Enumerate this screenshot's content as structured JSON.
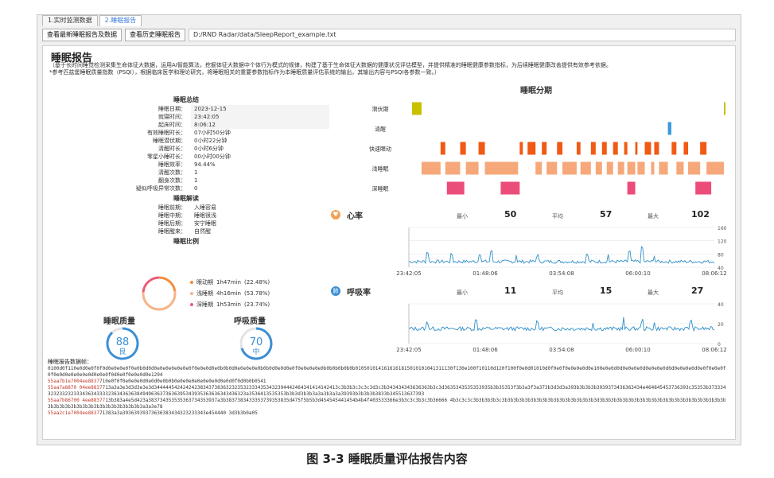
{
  "tabs": [
    {
      "label": "1.实时监测数据"
    },
    {
      "label": "2.睡眠报告"
    }
  ],
  "toolbar": {
    "btn_latest": "查看最新睡眠报告及数据",
    "btn_history": "查看历史睡眠报告",
    "path": "D:/RND Radar/data/SleepReport_example.txt"
  },
  "report": {
    "title": "睡眠报告",
    "intro1": "（基于长时间睡觉检测采集生命体征大数据，运用AI智能算法，挖掘体征大数据中个体行为模式的规律，构建了基于生命体征大数据的健康状况评估模型，并提供精准的睡眠健康参数指标，为后续睡眠健康改善提供有效参考依据。",
    "intro2": "*参考匹兹堡睡眠质量指数（PSQI），根据临床医学和理论研究，将睡眠相关的重要参数指标作为本睡眠质量评估系统的输出，其输出内容与PSQI各参数一致。）"
  },
  "summary": {
    "title": "睡眠总结",
    "rows": [
      {
        "k": "睡眠日期：",
        "v": "2023-12-15"
      },
      {
        "k": "就寝时间：",
        "v": "23:42:05"
      },
      {
        "k": "起床时间：",
        "v": "8:06:12"
      },
      {
        "k": "有效睡眠时长：",
        "v": "07小时50分钟"
      },
      {
        "k": "睡眠潜伏期：",
        "v": "0小时22分钟"
      },
      {
        "k": "清醒时长：",
        "v": "0小时6分钟"
      },
      {
        "k": "零星小睡时长：",
        "v": "00小时00分钟"
      },
      {
        "k": "睡眠效率：",
        "v": "94.44%"
      },
      {
        "k": "清醒次数：",
        "v": "1"
      },
      {
        "k": "翻身次数：",
        "v": "1"
      },
      {
        "k": "疑似呼吸异常次数：",
        "v": "0"
      }
    ],
    "interp_title": "睡眠解读",
    "interp": [
      {
        "k": "睡眠前期：",
        "v": "入睡容易"
      },
      {
        "k": "睡眠中期：",
        "v": "睡眠很浅"
      },
      {
        "k": "睡眠后期：",
        "v": "安宁睡眠"
      },
      {
        "k": "睡眠醒来：",
        "v": "自然醒"
      }
    ],
    "ratio_title": "睡眠比例",
    "ratio": [
      {
        "name": "眼动期",
        "time": "1h47min",
        "pct": "(22.48%)",
        "value": 22.48,
        "color": "#f28c3c"
      },
      {
        "name": "浅睡期",
        "time": "4h16min",
        "pct": "(53.78%)",
        "value": 53.78,
        "color": "#f6b48a"
      },
      {
        "name": "深睡期",
        "time": "1h53min",
        "pct": "(23.74%)",
        "value": 23.74,
        "color": "#ec5a78"
      }
    ]
  },
  "gauges": {
    "sleep": {
      "label": "睡眠质量",
      "score": "88",
      "grade": "良",
      "value": 88,
      "color": "#3b8fd6"
    },
    "breath": {
      "label": "呼吸质量",
      "score": "70",
      "grade": "中",
      "value": 70,
      "color": "#3b8fd6"
    }
  },
  "stages": {
    "title": "睡眠分期",
    "labels": [
      "潜伏期",
      "清醒",
      "快速眼动",
      "浅睡眠",
      "深睡眠"
    ],
    "colors": [
      "#c9c100",
      "#3a9bdc",
      "#f05a14",
      "#f6a87a",
      "#ec4c7a"
    ],
    "xticks": [
      "23:42:05",
      "01:48:06",
      "03:54:08",
      "06:00:10",
      "08:06:12"
    ],
    "segments": [
      {
        "s": 0,
        "a": 0.01,
        "b": 0.04
      },
      {
        "s": 0,
        "a": 0.995,
        "b": 1.0
      },
      {
        "s": 1,
        "a": 0.818,
        "b": 0.829
      },
      {
        "s": 2,
        "a": 0.1,
        "b": 0.115
      },
      {
        "s": 2,
        "a": 0.162,
        "b": 0.18
      },
      {
        "s": 2,
        "a": 0.22,
        "b": 0.24
      },
      {
        "s": 2,
        "a": 0.35,
        "b": 0.36
      },
      {
        "s": 2,
        "a": 0.375,
        "b": 0.4
      },
      {
        "s": 2,
        "a": 0.42,
        "b": 0.435
      },
      {
        "s": 2,
        "a": 0.468,
        "b": 0.485
      },
      {
        "s": 2,
        "a": 0.53,
        "b": 0.542
      },
      {
        "s": 2,
        "a": 0.575,
        "b": 0.59
      },
      {
        "s": 2,
        "a": 0.61,
        "b": 0.625
      },
      {
        "s": 2,
        "a": 0.645,
        "b": 0.66
      },
      {
        "s": 2,
        "a": 0.68,
        "b": 0.69
      },
      {
        "s": 2,
        "a": 0.715,
        "b": 0.722
      },
      {
        "s": 2,
        "a": 0.745,
        "b": 0.765
      },
      {
        "s": 2,
        "a": 0.775,
        "b": 0.79
      },
      {
        "s": 2,
        "a": 0.83,
        "b": 0.845
      },
      {
        "s": 2,
        "a": 0.868,
        "b": 0.882
      },
      {
        "s": 2,
        "a": 0.92,
        "b": 0.94
      },
      {
        "s": 3,
        "a": 0.04,
        "b": 0.1
      },
      {
        "s": 3,
        "a": 0.115,
        "b": 0.162
      },
      {
        "s": 3,
        "a": 0.18,
        "b": 0.22
      },
      {
        "s": 3,
        "a": 0.24,
        "b": 0.345
      },
      {
        "s": 3,
        "a": 0.4,
        "b": 0.42
      },
      {
        "s": 3,
        "a": 0.435,
        "b": 0.468
      },
      {
        "s": 3,
        "a": 0.485,
        "b": 0.53
      },
      {
        "s": 3,
        "a": 0.542,
        "b": 0.575
      },
      {
        "s": 3,
        "a": 0.59,
        "b": 0.61
      },
      {
        "s": 3,
        "a": 0.625,
        "b": 0.645
      },
      {
        "s": 3,
        "a": 0.66,
        "b": 0.68
      },
      {
        "s": 3,
        "a": 0.69,
        "b": 0.715
      },
      {
        "s": 3,
        "a": 0.722,
        "b": 0.745
      },
      {
        "s": 3,
        "a": 0.765,
        "b": 0.775
      },
      {
        "s": 3,
        "a": 0.79,
        "b": 0.818
      },
      {
        "s": 3,
        "a": 0.845,
        "b": 0.868
      },
      {
        "s": 3,
        "a": 0.882,
        "b": 0.92
      },
      {
        "s": 3,
        "a": 0.94,
        "b": 0.995
      },
      {
        "s": 4,
        "a": 0.12,
        "b": 0.175
      },
      {
        "s": 4,
        "a": 0.29,
        "b": 0.35
      },
      {
        "s": 4,
        "a": 0.69,
        "b": 0.715
      },
      {
        "s": 4,
        "a": 0.905,
        "b": 0.955
      }
    ]
  },
  "heart": {
    "title": "心率",
    "min_label": "最小",
    "min": "50",
    "avg_label": "平均",
    "avg": "57",
    "max_label": "最大",
    "max": "102",
    "yticks": [
      "160",
      "120",
      "80",
      "40"
    ],
    "ymin": 40,
    "ymax": 160,
    "xticks": [
      "23:42:05",
      "01:48:06",
      "03:54:08",
      "06:00:10",
      "08:06:12"
    ],
    "color": "#2f8fc7"
  },
  "breath": {
    "title": "呼吸率",
    "min_label": "最小",
    "min": "11",
    "avg_label": "平均",
    "avg": "15",
    "max_label": "最大",
    "max": "27",
    "yticks": [
      "40",
      "20",
      "0"
    ],
    "ymin": 0,
    "ymax": 40,
    "xticks": [
      "23:42:05",
      "01:48:06",
      "03:54:08",
      "06:00:10",
      "08:06:12"
    ],
    "color": "#2f8fc7"
  },
  "raw": {
    "title": "睡眠报告数据帧：",
    "line1": "0100d0f110e0d0e0f0f0d0e0e0e0f0e0b0d0d0e0e0e0e0e0e0f0e0e0d0e0b0b0d0e0e0e0e0b0b0d0e0d0e0f0e0e0e0e0b0b0b0b0b0b0105010141616161815010101041311130f130e100f10110d120f100f0e0d01010d0f0e0f0e0e0e0d0e100e0e0d0d0e0e0e0d0e0e0e0d0d0e0e0e0d0e0f0e0e0f0f0e0d0e0e0e0e0d0e0e0f0d0e0f0e0e0d0e1294",
    "l2a": "55aa7b1e7004ee8837",
    "l2b": "710e0f0f0e0e0e0d0e0d0e0b0b0e0e0e0e0e0e0e0d0e0d0f0d0b0b0541",
    "l3a": "55aa7a8870 04ee8837",
    "l3b": "713a3a3e3d3d3e3e3d3444445424242423834373836323235323334353432394442464341414142413c3b3b3c3c3c3d3c3b343434343636363b3c3d3635343535353935b3b35353f3b3a3f3a373b3d3d3a393b3b3b3b3939373436363434e464845453736393c35353b373334323233232333436343333236343636384949636373636395343935363636343436323a3536413535353b3b3d3b3b3a3a3b3a3a39393b3b3b3b3833b345513637393",
    "l4a": "55aa7b86700 4ee88377",
    "l4b": "13b383a4e5d423a383734353535363734353937a3b3837383433353739353835d475f5b5b3d454545441454b4b4f403533366e3b3c3c3b3c3b36666 4b3c3c3c3b3b3b3b3c3b3b3b3b3b3b3b3b3b3b3b3b3b3b3b3b3d3b3b3b3b3b3b3b3b3b3b3b3b3b3b3b3b3b3b3b3b3b3b3b3b3b3b3b3b3b3b3b3b3b3b3b3b3b3b3a3a3e78",
    "l5a": "55aa2c1e7004ee8837",
    "l5b": "71383a3a39363939373636383434323233343e454440 3d3b3b0a05"
  },
  "caption": "图 3-3  睡眠质量评估报告内容"
}
